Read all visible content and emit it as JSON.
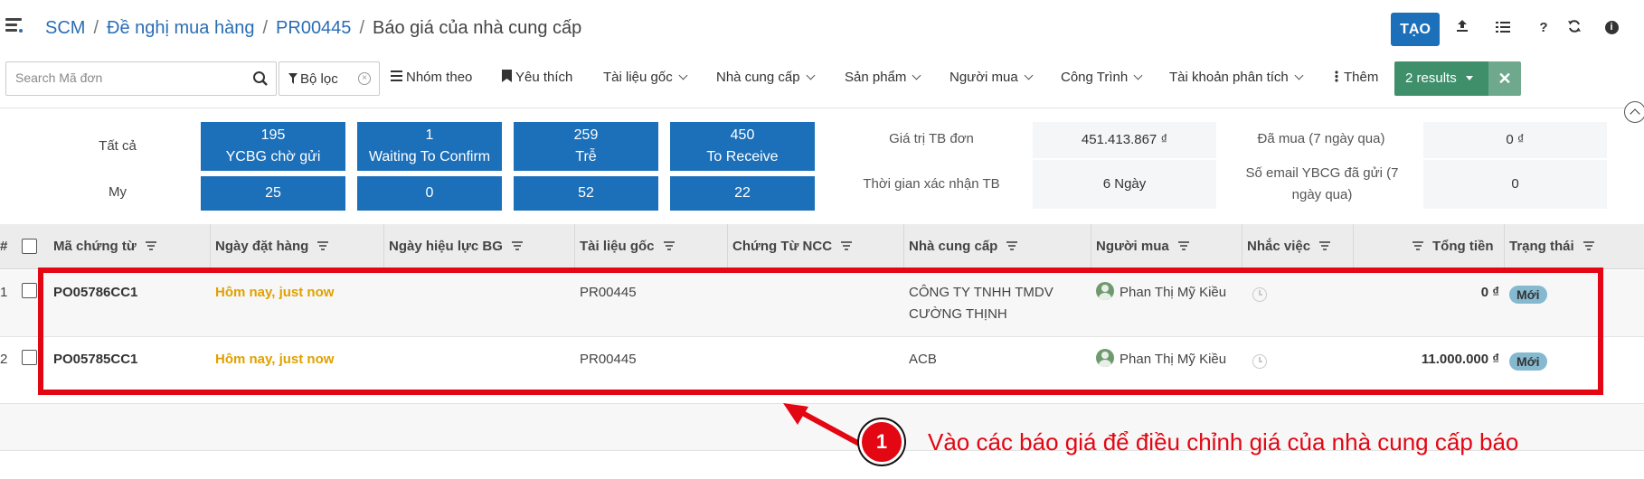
{
  "breadcrumb": [
    "SCM",
    "Đề nghị mua hàng",
    "PR00445",
    "Báo giá của nhà cung cấp"
  ],
  "header": {
    "create_label": "TẠO",
    "icons": [
      "upload-icon",
      "list-view-icon",
      "help-icon",
      "refresh-icon",
      "info-icon"
    ],
    "help_glyph": "?",
    "info_glyph": "i"
  },
  "search": {
    "placeholder": "Search Mã đơn",
    "value": ""
  },
  "filters": {
    "active_filter": "Bộ lọc",
    "group_by": "Nhóm theo",
    "favorites": "Yêu thích",
    "dropdowns": [
      "Tài liệu gốc",
      "Nhà cung cấp",
      "Sản phẩm",
      "Người mua",
      "Công Trình",
      "Tài khoản phân tích"
    ],
    "more": "Thêm",
    "results": "2 results"
  },
  "dashboard": {
    "row_all": "Tất cả",
    "row_my": "My",
    "tiles": [
      {
        "all": "195",
        "label": "YCBG chờ gửi",
        "my": "25"
      },
      {
        "all": "1",
        "label": "Waiting To Confirm",
        "my": "0"
      },
      {
        "all": "259",
        "label": "Trễ",
        "my": "52"
      },
      {
        "all": "450",
        "label": "To Receive",
        "my": "22"
      }
    ],
    "stats": [
      {
        "label": "Giá trị TB đơn",
        "value": "451.413.867 ₫"
      },
      {
        "label": "Thời gian xác nhận TB",
        "value": "6  Ngày"
      },
      {
        "label": "Đã mua (7 ngày qua)",
        "value": "0 ₫"
      },
      {
        "label": "Số email YBCG đã gửi (7 ngày qua)",
        "value": "0"
      }
    ]
  },
  "table": {
    "columns": [
      "#",
      "Mã chứng từ",
      "Ngày đặt hàng",
      "Ngày hiệu lực BG",
      "Tài liệu gốc",
      "Chứng Từ NCC",
      "Nhà cung cấp",
      "Người mua",
      "Nhắc việc",
      "Tổng tiền",
      "Trạng thái"
    ],
    "rows": [
      {
        "index": "1",
        "code": "PO05786CC1",
        "order_date": "Hôm nay, just now",
        "valid_date": "",
        "source": "PR00445",
        "vendor_ref": "",
        "vendor": "CÔNG TY TNHH TMDV CƯỜNG THỊNH",
        "buyer": "Phan Thị Mỹ Kiều",
        "total": "0 ₫",
        "status": "Mới"
      },
      {
        "index": "2",
        "code": "PO05785CC1",
        "order_date": "Hôm nay, just now",
        "valid_date": "",
        "source": "PR00445",
        "vendor_ref": "",
        "vendor": "ACB",
        "buyer": "Phan Thị Mỹ Kiều",
        "total": "11.000.000 ₫",
        "status": "Mới"
      }
    ]
  },
  "annotation": {
    "step": "1",
    "text": "Vào các báo giá để điều chỉnh giá của nhà cung cấp báo",
    "color": "#e30613"
  },
  "colors": {
    "primary": "#1c6fb9",
    "success": "#3f8f6b",
    "date_highlight": "#e0a100",
    "status_badge": "#85b9cf"
  }
}
